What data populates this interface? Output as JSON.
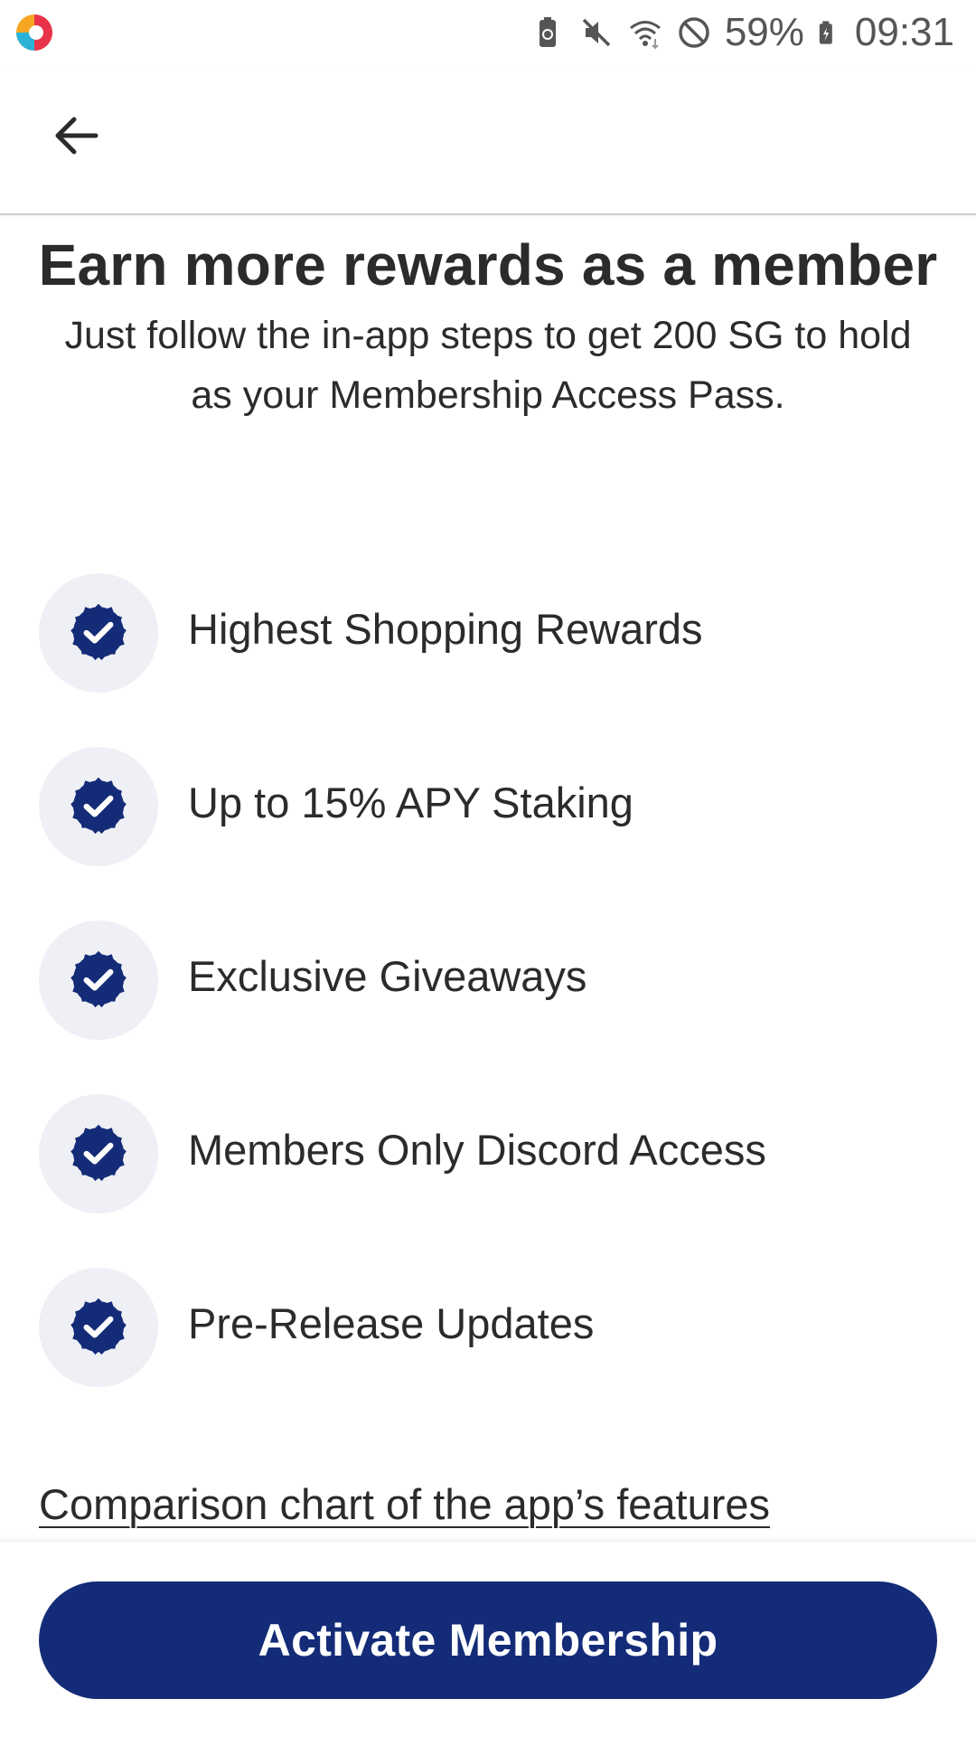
{
  "status_bar": {
    "battery_percent": "59%",
    "time": "09:31",
    "icons": [
      "app-logo-icon",
      "battery-saver-icon",
      "mute-icon",
      "wifi-icon",
      "do-not-disturb-icon",
      "battery-charging-icon"
    ]
  },
  "app_bar": {
    "back_icon": "arrow-left-icon"
  },
  "header": {
    "title": "Earn more rewards as a member",
    "subtitle": "Just follow the in-app steps to get 200 SG to hold as your Membership Access Pass."
  },
  "benefits": [
    {
      "label": "Highest Shopping Rewards",
      "icon": "verified-check-icon"
    },
    {
      "label": "Up to 15% APY Staking",
      "icon": "verified-check-icon"
    },
    {
      "label": "Exclusive Giveaways",
      "icon": "verified-check-icon"
    },
    {
      "label": "Members Only Discord Access",
      "icon": "verified-check-icon"
    },
    {
      "label": "Pre-Release Updates",
      "icon": "verified-check-icon"
    }
  ],
  "comparison_link": "Comparison chart of the app’s features",
  "activate_button": "Activate Membership",
  "colors": {
    "primary": "#142c78",
    "badge_background": "#eff0f5",
    "text": "#2b2b2b"
  }
}
